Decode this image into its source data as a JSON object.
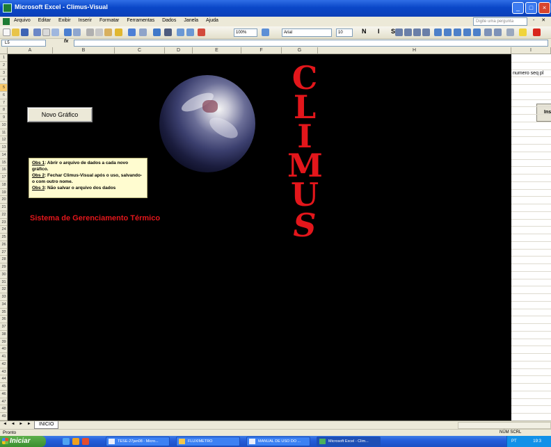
{
  "window": {
    "title": "Microsoft Excel - Climus-Visual",
    "buttons": [
      "minimize",
      "maximize",
      "close"
    ]
  },
  "menu": {
    "items": [
      "Arquivo",
      "Editar",
      "Exibir",
      "Inserir",
      "Formatar",
      "Ferramentas",
      "Dados",
      "Janela",
      "Ajuda"
    ],
    "ask_placeholder": "Digite uma pergunta"
  },
  "toolbar": {
    "zoom": "100%",
    "font_name": "Arial",
    "font_size": "10",
    "format_buttons": "N I S"
  },
  "formula_bar": {
    "name_box": "L5",
    "fx": "fx",
    "formula": ""
  },
  "columns": [
    "A",
    "B",
    "C",
    "D",
    "E",
    "F",
    "G",
    "H",
    "I"
  ],
  "rows": [
    "1",
    "2",
    "3",
    "4",
    "5",
    "6",
    "7",
    "8",
    "9",
    "10",
    "11",
    "12",
    "13",
    "14",
    "15",
    "16",
    "17",
    "18",
    "19",
    "20",
    "21",
    "22",
    "23",
    "24",
    "25",
    "26",
    "27",
    "28",
    "29",
    "30",
    "31",
    "32",
    "33",
    "34",
    "35",
    "36",
    "37",
    "38",
    "39",
    "40",
    "41",
    "42",
    "43",
    "44",
    "45",
    "46",
    "47",
    "48",
    "49"
  ],
  "selected_row": "5",
  "sheet": {
    "novo_button_label": "Novo Gráfico",
    "obs": [
      {
        "label": "Obs 1",
        "text": ": Abrir o arquivo de dados a cada novo gráfico."
      },
      {
        "label": "Obs 2",
        "text": ": Fechar Climus-Visual após o uso, salvando-o com outro nome."
      },
      {
        "label": "Obs 3",
        "text": ": Não salvar o arquivo dos dados"
      }
    ],
    "system_title": "Sistema de Gerenciamento Térmico",
    "climus_letters": [
      "C",
      "L",
      "I",
      "M",
      "U",
      "S"
    ],
    "right_cell_text": "numero seq  pl",
    "right_button_label": "Ins"
  },
  "sheet_tabs": {
    "nav": "◄ ◄ ► ►",
    "active_tab": "INICIO"
  },
  "status": {
    "left": "Pronto",
    "right": "NÚM SCRL"
  },
  "taskbar": {
    "start_label": "Iniciar",
    "tasks": [
      {
        "label": "TESE-27jan08 - Micro...",
        "active": false
      },
      {
        "label": "FLUXIMETRO",
        "active": false
      },
      {
        "label": "MANUAL DE USO DO ...",
        "active": false
      },
      {
        "label": "Microsoft Excel - Clim...",
        "active": true
      }
    ],
    "tray_lang": "PT",
    "tray_time": "19:3"
  },
  "colors": {
    "accent_red": "#e3161b",
    "sheet_bg": "#000000",
    "note_bg": "#fffcd0"
  }
}
